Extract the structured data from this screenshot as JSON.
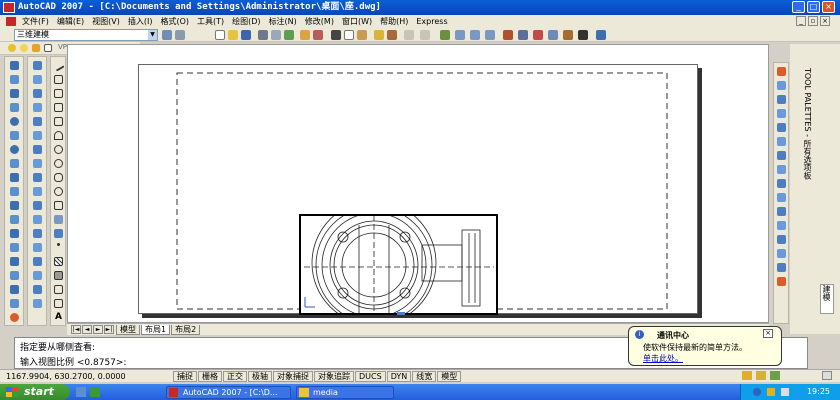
{
  "window": {
    "title": "AutoCAD 2007 - [C:\\Documents and Settings\\Administrator\\桌面\\座.dwg]",
    "min": "_",
    "max": "□",
    "close": "×"
  },
  "menu": [
    "文件(F)",
    "编辑(E)",
    "视图(V)",
    "插入(I)",
    "格式(O)",
    "工具(T)",
    "绘图(D)",
    "标注(N)",
    "修改(M)",
    "窗口(W)",
    "帮助(H)",
    "Express"
  ],
  "toolbar": {
    "workspace": "三维建模",
    "layer_value": "VPORTS"
  },
  "layout_tabs": [
    "模型",
    "布局1",
    "布局2"
  ],
  "command": {
    "line1": "指定要从哪侧查看:",
    "line2": "输入视图比例 <0.8757>:"
  },
  "status": {
    "coords": "1167.9904, 630.2700, 0.0000",
    "buttons": [
      "捕捉",
      "栅格",
      "正交",
      "极轴",
      "对象捕捉",
      "对象追踪",
      "DUCS",
      "DYN",
      "线宽",
      "模型"
    ]
  },
  "notification": {
    "title": "通讯中心",
    "body": "使软件保持最新的简单方法。",
    "link": "单击此处。",
    "close": "×"
  },
  "palette": {
    "title": "TOOL PALETTES - 所有选项板",
    "tab": "建模"
  },
  "taskbar": {
    "start": "start",
    "tasks": [
      "AutoCAD 2007 - [C:\\D...",
      "media"
    ],
    "clock": "19:25"
  },
  "colors": {
    "title_blue": "#0a5fd8",
    "xp_green": "#3a8a2e",
    "face": "#ece9d8",
    "link": "#0000cc"
  }
}
